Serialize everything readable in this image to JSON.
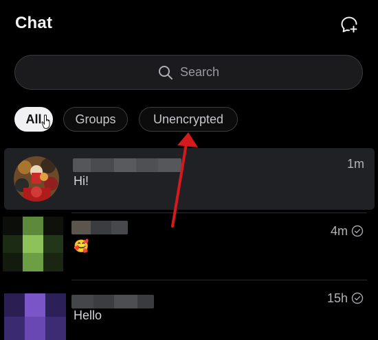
{
  "header": {
    "title": "Chat",
    "new_chat_icon": "new-chat-icon"
  },
  "search": {
    "placeholder": "Search",
    "icon": "search-icon"
  },
  "filters": [
    {
      "label": "All",
      "active": true
    },
    {
      "label": "Groups",
      "active": false
    },
    {
      "label": "Unencrypted",
      "active": false
    }
  ],
  "chats": [
    {
      "message": "Hi!",
      "time": "1m",
      "selected": true,
      "read_receipt": false
    },
    {
      "message": "🥰",
      "time": "4m",
      "selected": false,
      "read_receipt": true
    },
    {
      "message": "Hello",
      "time": "15h",
      "selected": false,
      "read_receipt": true
    }
  ],
  "colors": {
    "background": "#000000",
    "selected_row": "#202124",
    "annotation_arrow": "#d6191d"
  }
}
